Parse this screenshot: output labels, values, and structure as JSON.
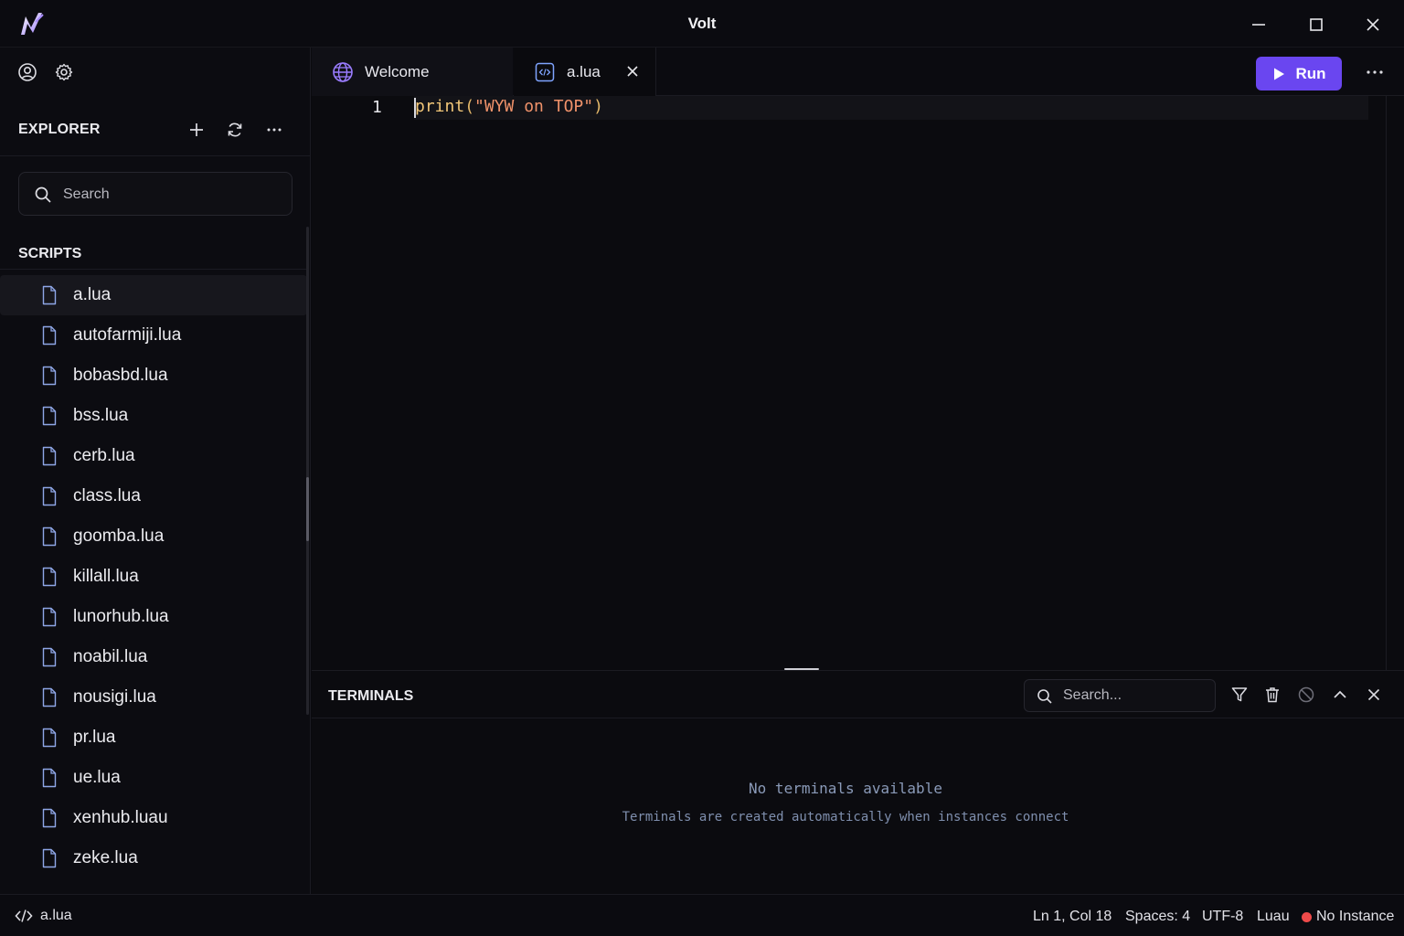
{
  "window": {
    "title": "Volt"
  },
  "sidebar": {
    "explorer_title": "EXPLORER",
    "search_placeholder": "Search",
    "section_title": "SCRIPTS",
    "files": [
      {
        "name": "a.lua",
        "active": true
      },
      {
        "name": "autofarmiji.lua"
      },
      {
        "name": "bobasbd.lua"
      },
      {
        "name": "bss.lua"
      },
      {
        "name": "cerb.lua"
      },
      {
        "name": "class.lua"
      },
      {
        "name": "goomba.lua"
      },
      {
        "name": "killall.lua"
      },
      {
        "name": "lunorhub.lua"
      },
      {
        "name": "noabil.lua"
      },
      {
        "name": "nousigi.lua"
      },
      {
        "name": "pr.lua"
      },
      {
        "name": "ue.lua"
      },
      {
        "name": "xenhub.luau"
      },
      {
        "name": "zeke.lua"
      }
    ]
  },
  "tabs": [
    {
      "label": "Welcome",
      "icon": "globe-icon"
    },
    {
      "label": "a.lua",
      "icon": "code-file-icon",
      "active": true
    }
  ],
  "toolbar": {
    "run_label": "Run"
  },
  "editor": {
    "line_number": "1",
    "code": {
      "fn": "print",
      "open": "(",
      "str": "\"WYW on TOP\"",
      "close": ")"
    }
  },
  "terminal": {
    "title": "TERMINALS",
    "search_placeholder": "Search...",
    "empty_title": "No terminals available",
    "empty_subtitle": "Terminals are created automatically when instances connect"
  },
  "status": {
    "file": "a.lua",
    "position": "Ln 1, Col 18",
    "spaces": "Spaces: 4",
    "encoding": "UTF-8",
    "language": "Luau",
    "instance": "No Instance"
  },
  "colors": {
    "accent": "#6a46f0",
    "status_error": "#ef4a4a",
    "background": "#0a0a0e"
  }
}
